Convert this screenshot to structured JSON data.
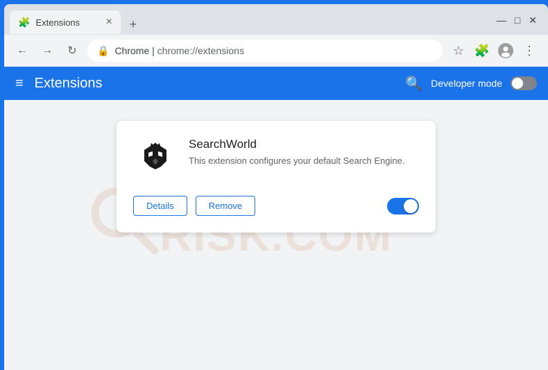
{
  "window": {
    "title": "Extensions",
    "tab_close": "×",
    "new_tab": "+",
    "controls": {
      "minimize": "—",
      "maximize": "□",
      "close": "✕"
    }
  },
  "addressbar": {
    "lock_icon": "🔒",
    "site_name": "Chrome",
    "separator": " | ",
    "url": "chrome://extensions",
    "star_tooltip": "Bookmark",
    "extensions_tooltip": "Extensions",
    "account_tooltip": "Account",
    "menu_tooltip": "Menu"
  },
  "extensions_header": {
    "title": "Extensions",
    "hamburger": "≡",
    "developer_mode_label": "Developer mode",
    "toggle_state": "off"
  },
  "extension_card": {
    "name": "SearchWorld",
    "description": "This extension configures your default Search Engine.",
    "details_label": "Details",
    "remove_label": "Remove",
    "enabled": true
  },
  "watermark": {
    "text": "RISK.COM"
  }
}
